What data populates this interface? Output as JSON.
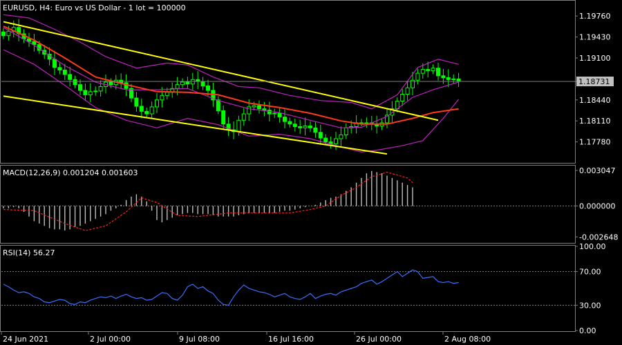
{
  "header": {
    "symbol_line": "EURUSD, H4:  Euro vs US Dollar - 1 lot = 100000"
  },
  "colors": {
    "background": "#000000",
    "grid": "#808080",
    "candle": "#00ff00",
    "ma": "#ff3a1a",
    "bollinger": "#c020c0",
    "trendline": "#ffff00",
    "macd_hist": "#c0c0c0",
    "macd_signal": "#ff2020",
    "rsi": "#3a6fff",
    "price_tag_bg": "#c0c0c0",
    "price_tag_fg": "#000000"
  },
  "chart_data": [
    {
      "type": "candlestick",
      "panel": "price",
      "title": "EURUSD, H4:  Euro vs US Dollar - 1 lot = 100000",
      "y_ticks": [
        "1.19760",
        "1.19430",
        "1.19100",
        "1.18731",
        "1.18440",
        "1.18110",
        "1.17780"
      ],
      "current_price": "1.18731",
      "ylim": [
        1.1745,
        1.1999
      ],
      "x_ticks": [
        "24 Jun 2021",
        "2 Jul 00:00",
        "9 Jul 08:00",
        "16 Jul 16:00",
        "26 Jul 00:00",
        "2 Aug 08:00"
      ],
      "close_series": [
        1.1945,
        1.1952,
        1.1958,
        1.1948,
        1.194,
        1.1936,
        1.1931,
        1.1922,
        1.1916,
        1.1908,
        1.1895,
        1.1891,
        1.1884,
        1.1876,
        1.1868,
        1.1859,
        1.1852,
        1.1857,
        1.1858,
        1.1865,
        1.1872,
        1.1868,
        1.1875,
        1.1871,
        1.1862,
        1.1847,
        1.1834,
        1.1826,
        1.1822,
        1.1833,
        1.1844,
        1.1851,
        1.1856,
        1.1862,
        1.1868,
        1.1872,
        1.1869,
        1.1876,
        1.1873,
        1.1866,
        1.1859,
        1.1844,
        1.1827,
        1.1806,
        1.1797,
        1.1794,
        1.1812,
        1.1822,
        1.1833,
        1.1835,
        1.183,
        1.1828,
        1.1822,
        1.1823,
        1.1817,
        1.181,
        1.1806,
        1.1802,
        1.18,
        1.1803,
        1.18,
        1.1793,
        1.1784,
        1.1778,
        1.1775,
        1.1783,
        1.1789,
        1.18,
        1.1802,
        1.1808,
        1.1808,
        1.1808,
        1.1806,
        1.1803,
        1.1808,
        1.182,
        1.183,
        1.1842,
        1.1853,
        1.1863,
        1.1875,
        1.1886,
        1.1892,
        1.189,
        1.1894,
        1.1882,
        1.1879,
        1.1876,
        1.1877,
        1.1873
      ],
      "moving_average": [
        {
          "x": 0,
          "y": 1.196
        },
        {
          "x": 6,
          "y": 1.1938
        },
        {
          "x": 12,
          "y": 1.191
        },
        {
          "x": 18,
          "y": 1.188
        },
        {
          "x": 24,
          "y": 1.1868
        },
        {
          "x": 30,
          "y": 1.1857
        },
        {
          "x": 36,
          "y": 1.1856
        },
        {
          "x": 42,
          "y": 1.1852
        },
        {
          "x": 48,
          "y": 1.1839
        },
        {
          "x": 54,
          "y": 1.1832
        },
        {
          "x": 60,
          "y": 1.1823
        },
        {
          "x": 66,
          "y": 1.1811
        },
        {
          "x": 70,
          "y": 1.1806
        },
        {
          "x": 75,
          "y": 1.1806
        },
        {
          "x": 80,
          "y": 1.1815
        },
        {
          "x": 84,
          "y": 1.1824
        },
        {
          "x": 89,
          "y": 1.183
        }
      ],
      "bollinger_upper": [
        {
          "x": 0,
          "y": 1.1978
        },
        {
          "x": 5,
          "y": 1.1973
        },
        {
          "x": 10,
          "y": 1.1955
        },
        {
          "x": 15,
          "y": 1.1935
        },
        {
          "x": 20,
          "y": 1.1912
        },
        {
          "x": 26,
          "y": 1.1894
        },
        {
          "x": 32,
          "y": 1.1902
        },
        {
          "x": 36,
          "y": 1.1899
        },
        {
          "x": 41,
          "y": 1.188
        },
        {
          "x": 46,
          "y": 1.1865
        },
        {
          "x": 50,
          "y": 1.1863
        },
        {
          "x": 56,
          "y": 1.1851
        },
        {
          "x": 62,
          "y": 1.1843
        },
        {
          "x": 68,
          "y": 1.184
        },
        {
          "x": 72,
          "y": 1.183
        },
        {
          "x": 77,
          "y": 1.1852
        },
        {
          "x": 81,
          "y": 1.1895
        },
        {
          "x": 85,
          "y": 1.1908
        },
        {
          "x": 89,
          "y": 1.19
        }
      ],
      "bollinger_middle": [
        {
          "x": 0,
          "y": 1.1958
        },
        {
          "x": 6,
          "y": 1.193
        },
        {
          "x": 12,
          "y": 1.1898
        },
        {
          "x": 18,
          "y": 1.1872
        },
        {
          "x": 24,
          "y": 1.186
        },
        {
          "x": 30,
          "y": 1.186
        },
        {
          "x": 36,
          "y": 1.1862
        },
        {
          "x": 42,
          "y": 1.1843
        },
        {
          "x": 48,
          "y": 1.183
        },
        {
          "x": 54,
          "y": 1.1824
        },
        {
          "x": 60,
          "y": 1.1812
        },
        {
          "x": 66,
          "y": 1.18
        },
        {
          "x": 70,
          "y": 1.1801
        },
        {
          "x": 75,
          "y": 1.1818
        },
        {
          "x": 80,
          "y": 1.1848
        },
        {
          "x": 84,
          "y": 1.186
        },
        {
          "x": 89,
          "y": 1.1872
        }
      ],
      "bollinger_lower": [
        {
          "x": 0,
          "y": 1.1923
        },
        {
          "x": 6,
          "y": 1.19
        },
        {
          "x": 12,
          "y": 1.1867
        },
        {
          "x": 18,
          "y": 1.1832
        },
        {
          "x": 24,
          "y": 1.1812
        },
        {
          "x": 30,
          "y": 1.18
        },
        {
          "x": 36,
          "y": 1.1815
        },
        {
          "x": 42,
          "y": 1.1805
        },
        {
          "x": 48,
          "y": 1.1787
        },
        {
          "x": 54,
          "y": 1.179
        },
        {
          "x": 60,
          "y": 1.1783
        },
        {
          "x": 66,
          "y": 1.177
        },
        {
          "x": 70,
          "y": 1.1762
        },
        {
          "x": 73,
          "y": 1.1765
        },
        {
          "x": 78,
          "y": 1.1772
        },
        {
          "x": 82,
          "y": 1.178
        },
        {
          "x": 86,
          "y": 1.1815
        },
        {
          "x": 89,
          "y": 1.1845
        }
      ],
      "trendlines": [
        {
          "x1": 0,
          "y1": 1.1967,
          "x2": 85,
          "y2": 1.1812
        },
        {
          "x1": 0,
          "y1": 1.185,
          "x2": 75,
          "y2": 1.1759
        }
      ]
    },
    {
      "type": "histogram",
      "panel": "macd",
      "title": "MACD(12,26,9) 0.001204 0.001603",
      "y_ticks": [
        "0.003047",
        "0.000000",
        "-0.002648"
      ],
      "ylim": [
        -0.0031,
        0.0034
      ],
      "histogram": [
        -0.0002,
        -0.0002,
        -0.0001,
        -0.0002,
        -0.0005,
        -0.0009,
        -0.0013,
        -0.0015,
        -0.0017,
        -0.0019,
        -0.002,
        -0.002,
        -0.0021,
        -0.002,
        -0.0018,
        -0.0017,
        -0.0015,
        -0.0013,
        -0.0011,
        -0.0009,
        -0.0007,
        -0.0004,
        -0.0002,
        0.0001,
        0.0005,
        0.0008,
        0.001,
        0.0008,
        0.0004,
        -0.0004,
        -0.0012,
        -0.0014,
        -0.0012,
        -0.001,
        -0.0008,
        -0.0007,
        -0.0006,
        -0.0006,
        -0.0007,
        -0.0007,
        -0.0007,
        -0.0008,
        -0.0009,
        -0.0009,
        -0.0009,
        -0.0009,
        -0.0008,
        -0.0007,
        -0.0006,
        -0.0006,
        -0.0006,
        -0.0006,
        -0.0006,
        -0.0006,
        -0.0005,
        -0.0004,
        -0.0004,
        -0.0003,
        -0.0002,
        -0.0001,
        0.0,
        0.0001,
        0.0003,
        0.0005,
        0.0007,
        0.0008,
        0.001,
        0.0013,
        0.0016,
        0.002,
        0.0024,
        0.0028,
        0.003,
        0.0029,
        0.0028,
        0.0026,
        0.0024,
        0.0022,
        0.002,
        0.0018,
        0.0016
      ],
      "signal": [
        {
          "x": 0,
          "y": -0.0003
        },
        {
          "x": 6,
          "y": -0.0004
        },
        {
          "x": 12,
          "y": -0.0015
        },
        {
          "x": 16,
          "y": -0.0021
        },
        {
          "x": 20,
          "y": -0.0017
        },
        {
          "x": 24,
          "y": -0.0005
        },
        {
          "x": 27,
          "y": 0.0007
        },
        {
          "x": 30,
          "y": 0.0003
        },
        {
          "x": 34,
          "y": -0.0008
        },
        {
          "x": 38,
          "y": -0.0009
        },
        {
          "x": 44,
          "y": -0.0006
        },
        {
          "x": 50,
          "y": -0.0006
        },
        {
          "x": 56,
          "y": -0.0006
        },
        {
          "x": 60,
          "y": -0.0003
        },
        {
          "x": 63,
          "y": 0.0
        },
        {
          "x": 66,
          "y": 0.0009
        },
        {
          "x": 69,
          "y": 0.0016
        },
        {
          "x": 72,
          "y": 0.0025
        },
        {
          "x": 75,
          "y": 0.0029
        },
        {
          "x": 79,
          "y": 0.0024
        },
        {
          "x": 80,
          "y": 0.002
        }
      ]
    },
    {
      "type": "line",
      "panel": "rsi",
      "title": "RSI(14) 56.27",
      "y_ticks": [
        "100.00",
        "70.00",
        "30.00",
        "0.00"
      ],
      "levels": [
        70,
        30
      ],
      "ylim": [
        0,
        100
      ],
      "values": [
        55,
        52,
        48,
        45,
        46,
        44,
        40,
        38,
        34,
        33,
        35,
        37,
        36,
        32,
        31,
        34,
        33,
        36,
        38,
        40,
        39,
        41,
        38,
        41,
        43,
        40,
        38,
        39,
        36,
        37,
        41,
        45,
        44,
        38,
        36,
        42,
        52,
        55,
        50,
        52,
        47,
        44,
        36,
        31,
        30,
        40,
        48,
        54,
        50,
        48,
        46,
        45,
        43,
        40,
        42,
        44,
        40,
        38,
        37,
        40,
        44,
        38,
        41,
        43,
        44,
        42,
        46,
        48,
        50,
        52,
        56,
        58,
        60,
        55,
        58,
        62,
        66,
        70,
        64,
        68,
        72,
        70,
        62,
        63,
        64,
        58,
        57,
        58,
        56,
        57
      ]
    }
  ]
}
